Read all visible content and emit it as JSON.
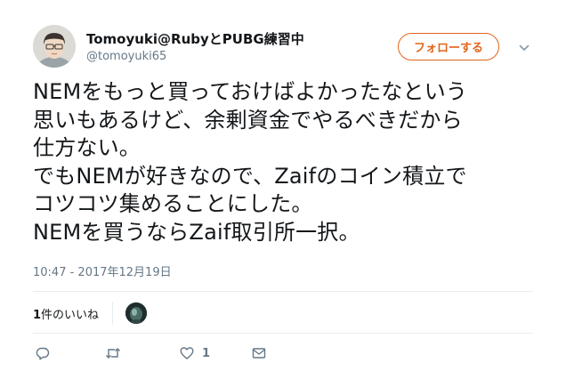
{
  "user": {
    "display_name": "Tomoyuki@RubyとPUBG練習中",
    "handle": "@tomoyuki65"
  },
  "follow_button": {
    "label": "フォローする"
  },
  "tweet": {
    "lines": [
      "NEMをもっと買っておけばよかったなという",
      "思いもあるけど、余剰資金でやるべきだから",
      "仕方ない。",
      "でもNEMが好きなので、Zaifのコイン積立で",
      "コツコツ集めることにした。",
      "NEMを買うならZaif取引所一択。"
    ],
    "timestamp": "10:47 - 2017年12月19日"
  },
  "likes": {
    "count": "1",
    "label": "件のいいね"
  },
  "actions": {
    "like_count": "1"
  },
  "colors": {
    "accent": "#e0651b",
    "muted": "#657786",
    "text": "#14171a"
  },
  "icons": [
    "reply-icon",
    "retweet-icon",
    "like-icon",
    "message-icon",
    "chevron-down-icon"
  ]
}
